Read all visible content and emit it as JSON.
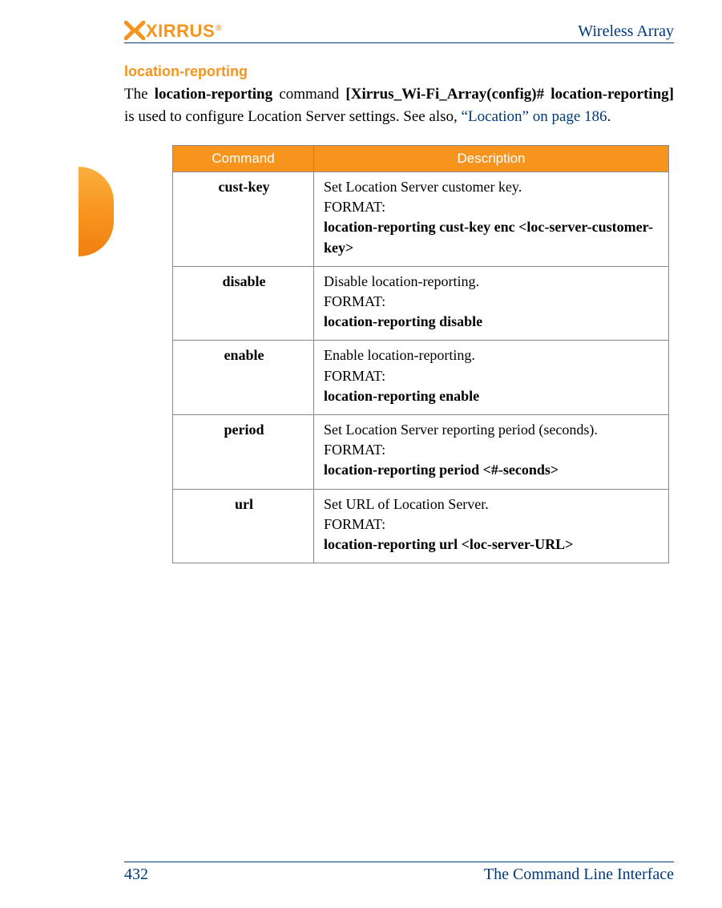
{
  "header": {
    "logo_text": "XIRRUS",
    "right": "Wireless Array"
  },
  "section": {
    "heading": "location-reporting",
    "para_parts": {
      "p1": "The ",
      "b1": "location-reporting",
      "p2": " command ",
      "b2": "[Xirrus_Wi-Fi_Array(config)# location-reporting]",
      "p3": " is used to configure Location Server settings. See also, ",
      "link": "“Location” on page 186",
      "p4": "."
    }
  },
  "table": {
    "headers": {
      "command": "Command",
      "description": "Description"
    },
    "format_label": "FORMAT:",
    "rows": [
      {
        "command": "cust-key",
        "desc": " Set Location Server customer key.",
        "code": "location-reporting cust-key enc <loc-server-customer-key>"
      },
      {
        "command": "disable",
        "desc": "Disable location-reporting.",
        "code": "location-reporting disable"
      },
      {
        "command": "enable",
        "desc": "Enable location-reporting.",
        "code": "location-reporting enable"
      },
      {
        "command": "period",
        "desc": " Set Location Server reporting period (seconds).",
        "code": "location-reporting period <#-seconds>"
      },
      {
        "command": "url",
        "desc": " Set URL of Location Server.",
        "code": "location-reporting url <loc-server-URL>"
      }
    ]
  },
  "footer": {
    "page": "432",
    "title": "The Command Line Interface"
  }
}
